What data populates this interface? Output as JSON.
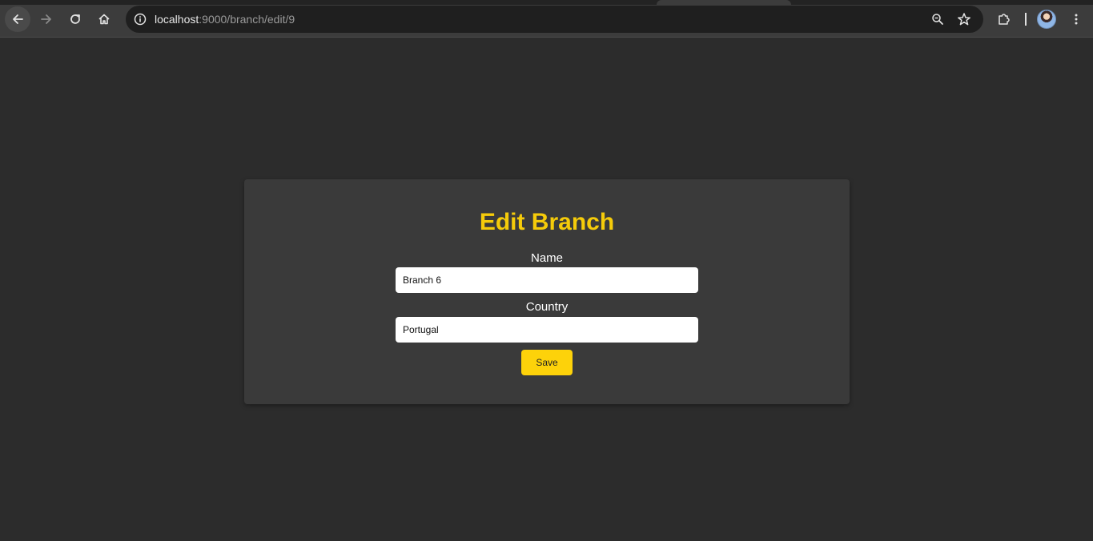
{
  "browser": {
    "url_host": "localhost",
    "url_path": ":9000/branch/edit/9",
    "icons": {
      "back": "back-arrow-icon",
      "forward": "forward-arrow-icon",
      "reload": "reload-icon",
      "home": "home-icon",
      "site_info": "info-icon",
      "zoom": "zoom-out-icon",
      "bookmark": "star-icon",
      "extensions": "puzzle-icon",
      "profile": "avatar",
      "menu": "kebab-menu-icon"
    }
  },
  "form": {
    "title": "Edit Branch",
    "name_label": "Name",
    "name_value": "Branch 6",
    "country_label": "Country",
    "country_value": "Portugal",
    "save_label": "Save"
  },
  "colors": {
    "page_background": "#2c2c2c",
    "card_background": "#3a3a3a",
    "accent": "#fdd20a",
    "title": "#f5cb0a"
  }
}
